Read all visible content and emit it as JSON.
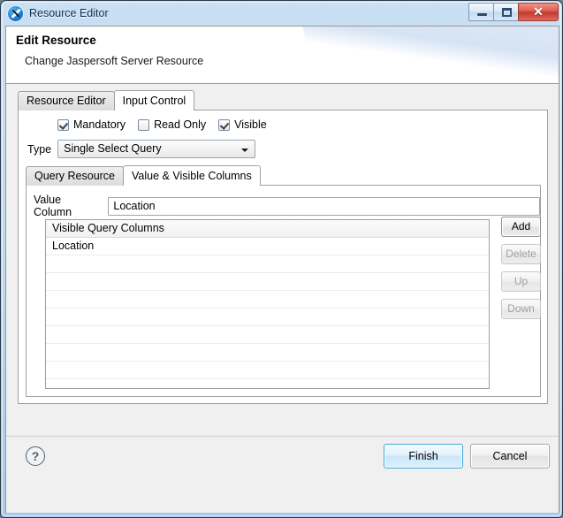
{
  "window": {
    "title": "Resource Editor",
    "icon": "jaspersoft-icon",
    "controls": {
      "minimize": "minimize-icon",
      "maximize": "maximize-icon",
      "close": "✕"
    }
  },
  "header": {
    "title": "Edit Resource",
    "subtitle": "Change Jaspersoft Server Resource"
  },
  "outer_tabs": [
    {
      "label": "Resource Editor",
      "selected": false
    },
    {
      "label": "Input Control",
      "selected": true
    }
  ],
  "checkboxes": [
    {
      "label": "Mandatory",
      "checked": true
    },
    {
      "label": "Read Only",
      "checked": false
    },
    {
      "label": "Visible",
      "checked": true
    }
  ],
  "type_field": {
    "label": "Type",
    "value": "Single Select Query",
    "arrow": "chevron-down-icon"
  },
  "inner_tabs": [
    {
      "label": "Query Resource",
      "selected": false
    },
    {
      "label": "Value & Visible Columns",
      "selected": true
    }
  ],
  "value_column": {
    "label": "Value Column",
    "value": "Location",
    "placeholder": ""
  },
  "table": {
    "header": "Visible Query Columns",
    "rows": [
      "Location",
      "",
      "",
      "",
      "",
      "",
      "",
      "",
      ""
    ]
  },
  "side_buttons": [
    {
      "label": "Add",
      "enabled": true
    },
    {
      "label": "Delete",
      "enabled": false
    },
    {
      "label": "Up",
      "enabled": false
    },
    {
      "label": "Down",
      "enabled": false
    }
  ],
  "footer": {
    "help": "?",
    "finish": "Finish",
    "cancel": "Cancel"
  },
  "colors": {
    "titlebar": "#bcd7ef",
    "close_button": "#c3372c",
    "default_button_border": "#3ea6dd"
  }
}
